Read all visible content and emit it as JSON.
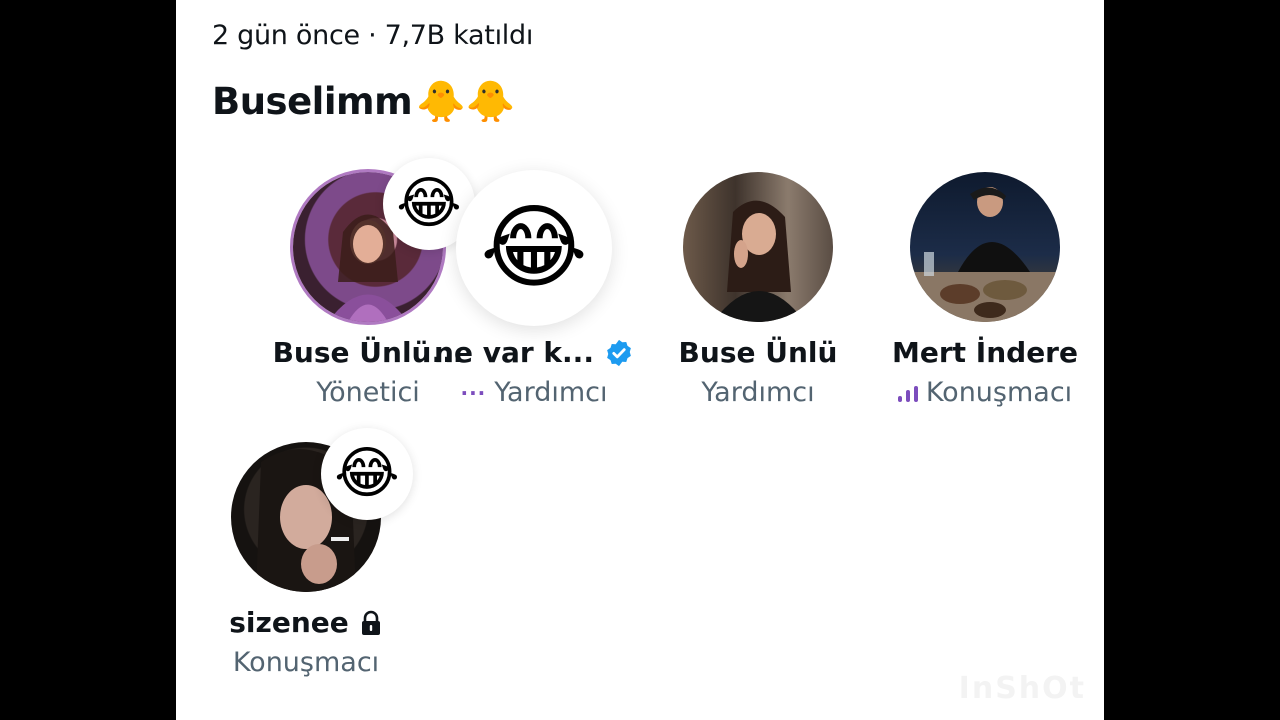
{
  "space": {
    "meta": "2 gün önce · 7,7B katıldı",
    "title": "Buselimm",
    "title_emoji": "🐥🐥"
  },
  "members": [
    {
      "name": "Buse Ünlü...",
      "role": "Yönetici",
      "reaction": "😂",
      "avatar_icon": "photo-woman-purple"
    },
    {
      "name": "ne var k...",
      "role": "Yardımcı",
      "avatar_emoji": "😂",
      "verified": true,
      "role_icon": "more-dots-icon"
    },
    {
      "name": "Buse Ünlü",
      "role": "Yardımcı",
      "avatar_icon": "photo-woman-black-jacket"
    },
    {
      "name": "Mert İndere",
      "role": "Konuşmacı",
      "avatar_icon": "photo-man-dinner",
      "role_icon": "speaking-bars-icon"
    },
    {
      "name": "sizenee",
      "role": "Konuşmacı",
      "reaction": "😂",
      "locked": true,
      "avatar_icon": "photo-woman-dark-hair"
    }
  ],
  "colors": {
    "text_primary": "#0f1419",
    "text_secondary": "#536471",
    "verified_blue": "#1d9bf0",
    "speaker_purple": "#7c4dbd"
  },
  "watermark": "InShOt"
}
